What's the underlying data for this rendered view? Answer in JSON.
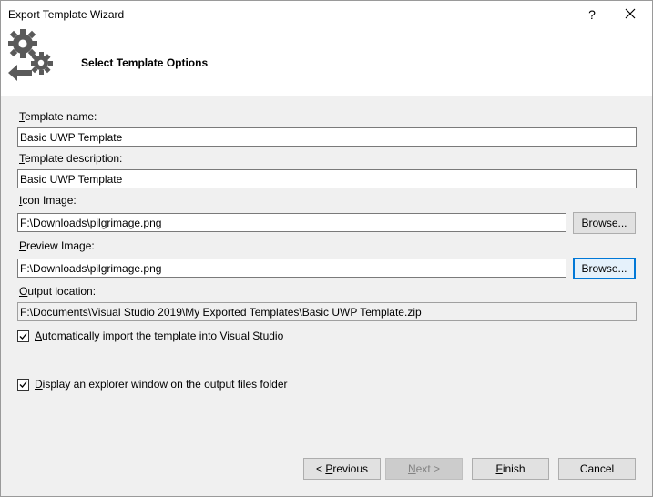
{
  "window": {
    "title": "Export Template Wizard",
    "help_glyph": "?",
    "close_icon": "close-icon"
  },
  "header": {
    "title": "Select Template Options",
    "icon": "gears-export-icon"
  },
  "form": {
    "template_name": {
      "label_key": "T",
      "label_rest": "emplate name:",
      "value": "Basic UWP Template"
    },
    "template_description": {
      "label_key": "T",
      "label_rest": "emplate description:",
      "value": "Basic UWP Template"
    },
    "icon_image": {
      "label_key": "I",
      "label_rest": "con Image:",
      "value": "F:\\Downloads\\pilgrimage.png",
      "browse": "Browse..."
    },
    "preview_image": {
      "label_key": "P",
      "label_rest": "review Image:",
      "value": "F:\\Downloads\\pilgrimage.png",
      "browse": "Browse..."
    },
    "output_location": {
      "label_key": "O",
      "label_rest": "utput location:",
      "value": "F:\\Documents\\Visual Studio 2019\\My Exported Templates\\Basic UWP Template.zip"
    }
  },
  "options": {
    "auto_import": {
      "key": "A",
      "rest": "utomatically import the template into Visual Studio",
      "checked": true
    },
    "display_explorer": {
      "key": "D",
      "rest": "isplay an explorer window on the output files folder",
      "checked": true
    }
  },
  "buttons": {
    "previous": {
      "prefix": "< ",
      "key": "P",
      "rest": "revious"
    },
    "next": {
      "key": "N",
      "rest": "ext >",
      "disabled": true
    },
    "finish": {
      "key": "F",
      "rest": "inish"
    },
    "cancel": {
      "label": "Cancel"
    }
  },
  "colors": {
    "focus_border": "#0078d7",
    "header_bg": "#ffffff",
    "body_bg": "#f0f0f0"
  }
}
